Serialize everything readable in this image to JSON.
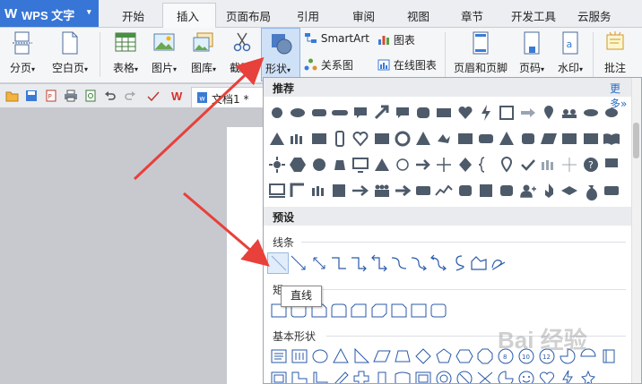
{
  "app": {
    "logo": "W",
    "name": "WPS 文字",
    "menu_arrow": "▾"
  },
  "tabs": [
    "开始",
    "插入",
    "页面布局",
    "引用",
    "审阅",
    "视图",
    "章节",
    "开发工具",
    "云服务"
  ],
  "ribbon": {
    "page_break": "分页",
    "blank_page": "空白页",
    "table": "表格",
    "picture": "图片",
    "gallery": "图库",
    "screenshot": "截屏",
    "shapes": "形状",
    "smartart": "SmartArt",
    "chart": "图表",
    "relation_chart": "关系图",
    "online_chart": "在线图表",
    "header_footer": "页眉和页脚",
    "page_number": "页码",
    "watermark": "水印",
    "comment": "批注",
    "dropdown_arrow": "▾"
  },
  "quick_access": {
    "doc_tab": "文档1 *"
  },
  "panel": {
    "recommended": "推荐",
    "more": "更多»",
    "preset": "预设",
    "lines": "线条",
    "rectangles": "矩",
    "basic_shapes": "基本形状",
    "tooltip": "直线"
  },
  "watermark_text": "Bai 经验",
  "colors": {
    "accent": "#3776d6",
    "shape_fill": "#4d5a6a",
    "line_blue": "#2a5aa8",
    "arrow_red": "#e8403a"
  }
}
